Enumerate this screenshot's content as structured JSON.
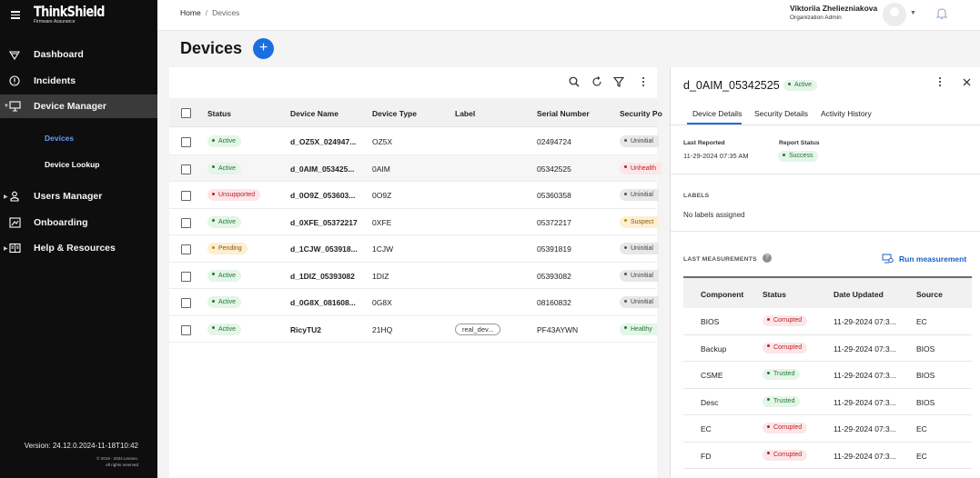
{
  "brand": {
    "name": "ThinkShield",
    "tagline": "Firmware Assurance"
  },
  "nav": {
    "dashboard": "Dashboard",
    "incidents": "Incidents",
    "device_manager": "Device Manager",
    "devices": "Devices",
    "device_lookup": "Device Lookup",
    "users_manager": "Users Manager",
    "onboarding": "Onboarding",
    "help": "Help & Resources"
  },
  "footer": {
    "version": "Version: 24.12.0.2024-11-18T10:42",
    "copyright": "© 2019 - 2024 Lenovo.",
    "rights": "All rights reserved"
  },
  "breadcrumb": {
    "home": "Home",
    "sep": "/",
    "current": "Devices"
  },
  "user": {
    "name": "Viktoriia Zheliezniakova",
    "role": "Organization Admin"
  },
  "page": {
    "title": "Devices",
    "add": "+"
  },
  "table": {
    "headers": [
      "Status",
      "Device Name",
      "Device Type",
      "Label",
      "Serial Number",
      "Security Po"
    ],
    "rows": [
      {
        "status": "Active",
        "name": "d_OZ5X_024947...",
        "type": "OZ5X",
        "label": "",
        "serial": "02494724",
        "security": "Uninitial"
      },
      {
        "status": "Active",
        "name": "d_0AIM_053425...",
        "type": "0AIM",
        "label": "",
        "serial": "05342525",
        "security": "Unhealth"
      },
      {
        "status": "Unsupported",
        "name": "d_0O9Z_053603...",
        "type": "0O9Z",
        "label": "",
        "serial": "05360358",
        "security": "Uninitial"
      },
      {
        "status": "Active",
        "name": "d_0XFE_05372217",
        "type": "0XFE",
        "label": "",
        "serial": "05372217",
        "security": "Suspect"
      },
      {
        "status": "Pending",
        "name": "d_1CJW_053918...",
        "type": "1CJW",
        "label": "",
        "serial": "05391819",
        "security": "Uninitial"
      },
      {
        "status": "Active",
        "name": "d_1DIZ_05393082",
        "type": "1DIZ",
        "label": "",
        "serial": "05393082",
        "security": "Uninitial"
      },
      {
        "status": "Active",
        "name": "d_0G8X_081608...",
        "type": "0G8X",
        "label": "",
        "serial": "08160832",
        "security": "Uninitial"
      },
      {
        "status": "Active",
        "name": "RicyTU2",
        "type": "21HQ",
        "label": "real_dev...",
        "serial": "PF43AYWN",
        "security": "Healthy"
      }
    ]
  },
  "detail": {
    "title": "d_0AIM_05342525",
    "status": "Active",
    "tabs": [
      "Device Details",
      "Security Details",
      "Activity History"
    ],
    "last_reported_label": "Last Reported",
    "last_reported_value": "11-29-2024 07:35 AM",
    "report_status_label": "Report Status",
    "report_status_value": "Success",
    "labels_heading": "LABELS",
    "labels_value": "No labels assigned",
    "measurements_heading": "LAST MEASUREMENTS",
    "run_measurement": "Run measurement",
    "m_headers": [
      "Component",
      "Status",
      "Date Updated",
      "Source"
    ],
    "measurements": [
      {
        "component": "BIOS",
        "status": "Corrupted",
        "date": "11-29-2024 07:3...",
        "source": "EC"
      },
      {
        "component": "Backup",
        "status": "Corrupted",
        "date": "11-29-2024 07:3...",
        "source": "BIOS"
      },
      {
        "component": "CSME",
        "status": "Trusted",
        "date": "11-29-2024 07:3...",
        "source": "BIOS"
      },
      {
        "component": "Desc",
        "status": "Trusted",
        "date": "11-29-2024 07:3...",
        "source": "BIOS"
      },
      {
        "component": "EC",
        "status": "Corrupted",
        "date": "11-29-2024 07:3...",
        "source": "EC"
      },
      {
        "component": "FD",
        "status": "Corrupted",
        "date": "11-29-2024 07:3...",
        "source": "EC"
      }
    ]
  },
  "colors": {
    "accent": "#1a6fe0",
    "sidebar": "#0e0e0e",
    "active_nav": "#3a3a3a"
  }
}
